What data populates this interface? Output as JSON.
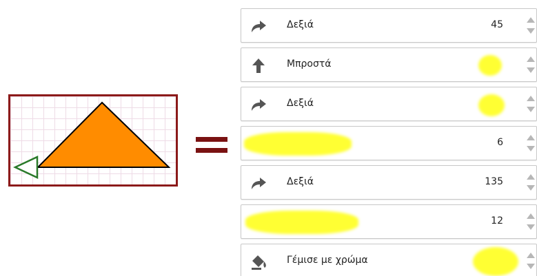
{
  "comparison": {
    "equals_sign": "="
  },
  "commands": [
    {
      "icon": "turn-right-icon",
      "label": "Δεξιά",
      "value": "45"
    },
    {
      "icon": "arrow-up-icon",
      "label": "Μπροστά",
      "value": ""
    },
    {
      "icon": "turn-right-icon",
      "label": "Δεξιά",
      "value": ""
    },
    {
      "icon": "",
      "label": "",
      "value": "6"
    },
    {
      "icon": "turn-right-icon",
      "label": "Δεξιά",
      "value": "135"
    },
    {
      "icon": "",
      "label": "",
      "value": "12"
    },
    {
      "icon": "paint-bucket-icon",
      "label": "Γέμισε με χρώμα",
      "value": ""
    }
  ],
  "colors": {
    "frame": "#8c1a1a",
    "triangle_fill": "#ff8c00",
    "turtle": "#2a7a2a",
    "highlight": "#ffff33"
  }
}
